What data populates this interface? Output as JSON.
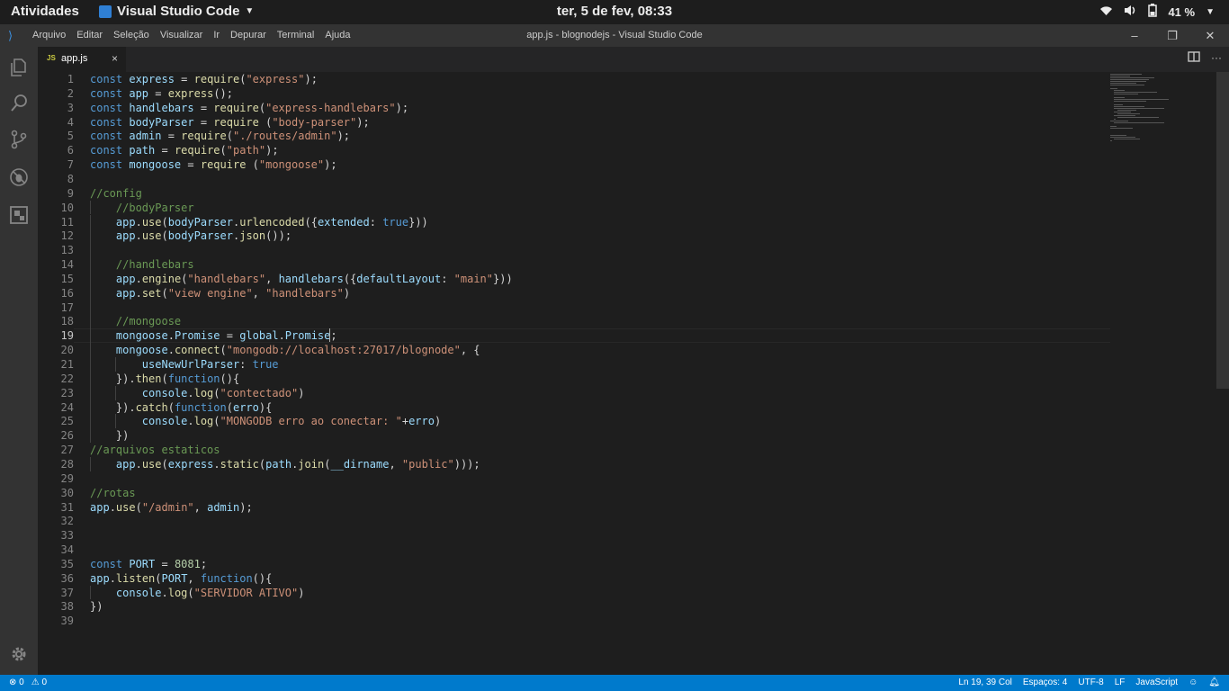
{
  "topbar": {
    "activities": "Atividades",
    "app_name": "Visual Studio Code",
    "clock": "ter,  5 de fev, 08:33",
    "battery": "41 %",
    "icons": [
      "wifi-icon",
      "volume-icon",
      "battery-icon",
      "power-menu-caret-icon"
    ]
  },
  "menubar": {
    "items": [
      "Arquivo",
      "Editar",
      "Seleção",
      "Visualizar",
      "Ir",
      "Depurar",
      "Terminal",
      "Ajuda"
    ],
    "window_title": "app.js - blognodejs - Visual Studio Code",
    "controls": [
      "minimize-icon",
      "restore-icon",
      "close-icon"
    ]
  },
  "activitybar": {
    "icons": [
      "explorer-icon",
      "search-icon",
      "source-control-icon",
      "debug-icon",
      "extensions-icon",
      "gear-icon"
    ]
  },
  "tab": {
    "icon": "JS",
    "name": "app.js",
    "close": "×"
  },
  "editor": {
    "current_line": 19,
    "lines": [
      [
        [
          "k",
          "const "
        ],
        [
          "v",
          "express"
        ],
        [
          "p",
          " = "
        ],
        [
          "f",
          "require"
        ],
        [
          "p",
          "("
        ],
        [
          "s",
          "\"express\""
        ],
        [
          "p",
          ");"
        ]
      ],
      [
        [
          "k",
          "const "
        ],
        [
          "v",
          "app"
        ],
        [
          "p",
          " = "
        ],
        [
          "f",
          "express"
        ],
        [
          "p",
          "();"
        ]
      ],
      [
        [
          "k",
          "const "
        ],
        [
          "v",
          "handlebars"
        ],
        [
          "p",
          " = "
        ],
        [
          "f",
          "require"
        ],
        [
          "p",
          "("
        ],
        [
          "s",
          "\"express-handlebars\""
        ],
        [
          "p",
          ");"
        ]
      ],
      [
        [
          "k",
          "const "
        ],
        [
          "v",
          "bodyParser"
        ],
        [
          "p",
          " = "
        ],
        [
          "f",
          "require"
        ],
        [
          "p",
          " ("
        ],
        [
          "s",
          "\"body-parser\""
        ],
        [
          "p",
          ");"
        ]
      ],
      [
        [
          "k",
          "const "
        ],
        [
          "v",
          "admin"
        ],
        [
          "p",
          " = "
        ],
        [
          "f",
          "require"
        ],
        [
          "p",
          "("
        ],
        [
          "s",
          "\"./routes/admin\""
        ],
        [
          "p",
          ");"
        ]
      ],
      [
        [
          "k",
          "const "
        ],
        [
          "v",
          "path"
        ],
        [
          "p",
          " = "
        ],
        [
          "f",
          "require"
        ],
        [
          "p",
          "("
        ],
        [
          "s",
          "\"path\""
        ],
        [
          "p",
          ");"
        ]
      ],
      [
        [
          "k",
          "const "
        ],
        [
          "v",
          "mongoose"
        ],
        [
          "p",
          " = "
        ],
        [
          "f",
          "require"
        ],
        [
          "p",
          " ("
        ],
        [
          "s",
          "\"mongoose\""
        ],
        [
          "p",
          ");"
        ]
      ],
      [],
      [
        [
          "c",
          "//config"
        ]
      ],
      [
        [
          "p",
          "    "
        ],
        [
          "c",
          "//bodyParser"
        ]
      ],
      [
        [
          "p",
          "    "
        ],
        [
          "v",
          "app"
        ],
        [
          "p",
          "."
        ],
        [
          "f",
          "use"
        ],
        [
          "p",
          "("
        ],
        [
          "v",
          "bodyParser"
        ],
        [
          "p",
          "."
        ],
        [
          "f",
          "urlencoded"
        ],
        [
          "p",
          "({"
        ],
        [
          "v",
          "extended"
        ],
        [
          "p",
          ": "
        ],
        [
          "k",
          "true"
        ],
        [
          "p",
          "}))"
        ]
      ],
      [
        [
          "p",
          "    "
        ],
        [
          "v",
          "app"
        ],
        [
          "p",
          "."
        ],
        [
          "f",
          "use"
        ],
        [
          "p",
          "("
        ],
        [
          "v",
          "bodyParser"
        ],
        [
          "p",
          "."
        ],
        [
          "f",
          "json"
        ],
        [
          "p",
          "());"
        ]
      ],
      [],
      [
        [
          "p",
          "    "
        ],
        [
          "c",
          "//handlebars"
        ]
      ],
      [
        [
          "p",
          "    "
        ],
        [
          "v",
          "app"
        ],
        [
          "p",
          "."
        ],
        [
          "f",
          "engine"
        ],
        [
          "p",
          "("
        ],
        [
          "s",
          "\"handlebars\""
        ],
        [
          "p",
          ", "
        ],
        [
          "v",
          "handlebars"
        ],
        [
          "p",
          "({"
        ],
        [
          "v",
          "defaultLayout"
        ],
        [
          "p",
          ": "
        ],
        [
          "s",
          "\"main\""
        ],
        [
          "p",
          "}))"
        ]
      ],
      [
        [
          "p",
          "    "
        ],
        [
          "v",
          "app"
        ],
        [
          "p",
          "."
        ],
        [
          "f",
          "set"
        ],
        [
          "p",
          "("
        ],
        [
          "s",
          "\"view engine\""
        ],
        [
          "p",
          ", "
        ],
        [
          "s",
          "\"handlebars\""
        ],
        [
          "p",
          ")"
        ]
      ],
      [],
      [
        [
          "p",
          "    "
        ],
        [
          "c",
          "//mongoose"
        ]
      ],
      [
        [
          "p",
          "    "
        ],
        [
          "v",
          "mongoose"
        ],
        [
          "p",
          "."
        ],
        [
          "v",
          "Promise"
        ],
        [
          "p",
          " = "
        ],
        [
          "v",
          "global"
        ],
        [
          "p",
          "."
        ],
        [
          "v",
          "Promise"
        ],
        [
          "p",
          ";"
        ]
      ],
      [
        [
          "p",
          "    "
        ],
        [
          "v",
          "mongoose"
        ],
        [
          "p",
          "."
        ],
        [
          "f",
          "connect"
        ],
        [
          "p",
          "("
        ],
        [
          "s",
          "\"mongodb://localhost:27017/blognode\""
        ],
        [
          "p",
          ", {"
        ]
      ],
      [
        [
          "p",
          "        "
        ],
        [
          "v",
          "useNewUrlParser"
        ],
        [
          "p",
          ": "
        ],
        [
          "k",
          "true"
        ]
      ],
      [
        [
          "p",
          "    })."
        ],
        [
          "f",
          "then"
        ],
        [
          "p",
          "("
        ],
        [
          "k",
          "function"
        ],
        [
          "p",
          "(){"
        ]
      ],
      [
        [
          "p",
          "        "
        ],
        [
          "v",
          "console"
        ],
        [
          "p",
          "."
        ],
        [
          "f",
          "log"
        ],
        [
          "p",
          "("
        ],
        [
          "s",
          "\"contectado\""
        ],
        [
          "p",
          ")"
        ]
      ],
      [
        [
          "p",
          "    })."
        ],
        [
          "f",
          "catch"
        ],
        [
          "p",
          "("
        ],
        [
          "k",
          "function"
        ],
        [
          "p",
          "("
        ],
        [
          "v",
          "erro"
        ],
        [
          "p",
          "){"
        ]
      ],
      [
        [
          "p",
          "        "
        ],
        [
          "v",
          "console"
        ],
        [
          "p",
          "."
        ],
        [
          "f",
          "log"
        ],
        [
          "p",
          "("
        ],
        [
          "s",
          "\"MONGODB erro ao conectar: \""
        ],
        [
          "p",
          "+"
        ],
        [
          "v",
          "erro"
        ],
        [
          "p",
          ")"
        ]
      ],
      [
        [
          "p",
          "    })"
        ]
      ],
      [
        [
          "c",
          "//arquivos estaticos"
        ]
      ],
      [
        [
          "p",
          "    "
        ],
        [
          "v",
          "app"
        ],
        [
          "p",
          "."
        ],
        [
          "f",
          "use"
        ],
        [
          "p",
          "("
        ],
        [
          "v",
          "express"
        ],
        [
          "p",
          "."
        ],
        [
          "f",
          "static"
        ],
        [
          "p",
          "("
        ],
        [
          "v",
          "path"
        ],
        [
          "p",
          "."
        ],
        [
          "f",
          "join"
        ],
        [
          "p",
          "("
        ],
        [
          "v",
          "__dirname"
        ],
        [
          "p",
          ", "
        ],
        [
          "s",
          "\"public\""
        ],
        [
          "p",
          ")));"
        ]
      ],
      [],
      [
        [
          "c",
          "//rotas"
        ]
      ],
      [
        [
          "v",
          "app"
        ],
        [
          "p",
          "."
        ],
        [
          "f",
          "use"
        ],
        [
          "p",
          "("
        ],
        [
          "s",
          "\"/admin\""
        ],
        [
          "p",
          ", "
        ],
        [
          "v",
          "admin"
        ],
        [
          "p",
          ");"
        ]
      ],
      [],
      [],
      [],
      [
        [
          "k",
          "const "
        ],
        [
          "v",
          "PORT"
        ],
        [
          "p",
          " = "
        ],
        [
          "n",
          "8081"
        ],
        [
          "p",
          ";"
        ]
      ],
      [
        [
          "v",
          "app"
        ],
        [
          "p",
          "."
        ],
        [
          "f",
          "listen"
        ],
        [
          "p",
          "("
        ],
        [
          "v",
          "PORT"
        ],
        [
          "p",
          ", "
        ],
        [
          "k",
          "function"
        ],
        [
          "p",
          "(){"
        ]
      ],
      [
        [
          "p",
          "    "
        ],
        [
          "v",
          "console"
        ],
        [
          "p",
          "."
        ],
        [
          "f",
          "log"
        ],
        [
          "p",
          "("
        ],
        [
          "s",
          "\"SERVIDOR ATIVO\""
        ],
        [
          "p",
          ")"
        ]
      ],
      [
        [
          "p",
          "})"
        ]
      ],
      []
    ]
  },
  "statusbar": {
    "errors": "⊗ 0",
    "warnings": "⚠ 0",
    "position": "Ln 19, 39 Col",
    "spaces": "Espaços: 4",
    "encoding": "UTF-8",
    "eol": "LF",
    "language": "JavaScript",
    "feedback_icon": "smiley-icon",
    "notifications_icon": "bell-icon"
  },
  "colors": {
    "accent": "#007acc",
    "editor_bg": "#1e1e1e",
    "keyword": "#569cd6",
    "string": "#ce9178",
    "comment": "#6a9955"
  }
}
